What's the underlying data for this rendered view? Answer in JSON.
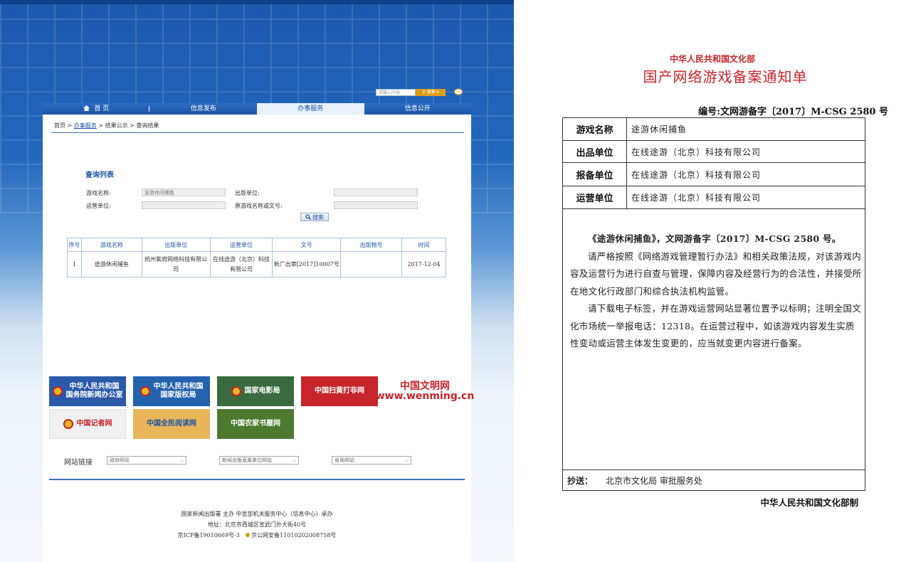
{
  "left": {
    "search": {
      "placeholder": "请输入内容",
      "button": "搜索"
    },
    "nav": {
      "items": [
        "首 页",
        "信息发布",
        "办事服务",
        "信息公开"
      ],
      "active_index": 2
    },
    "breadcrumb": {
      "home": "首页",
      "sep": " > ",
      "service": "办事服务",
      "rest": " > 结果公示 > 查询结果"
    },
    "list_title": "查询列表",
    "form": {
      "game_name_label": "游戏名称:",
      "game_name_value": "途游休闲捕鱼",
      "publisher_label": "出版单位:",
      "publisher_value": "",
      "operator_label": "运营单位:",
      "operator_value": "",
      "original_label": "原游戏名称或文号:",
      "original_value": "",
      "search_button": "搜索"
    },
    "table": {
      "headers": [
        "序号",
        "游戏名称",
        "出版单位",
        "运营单位",
        "文号",
        "出版物号",
        "时间"
      ],
      "rows": [
        [
          "1",
          "途游休闲捕鱼",
          "杭州紫府网络科技有限公司",
          "在线途游（北京）科技有限公司",
          "新广出审[2017]10007号",
          "",
          "2017-12-04"
        ]
      ]
    },
    "logos": [
      {
        "text": "中华人民共和国\n国务院新闻办公室",
        "color": "#2a5aa8"
      },
      {
        "text": "中华人民共和国\n国家版权局",
        "color": "#2462ad"
      },
      {
        "text": "国家电影局",
        "color": "#3a6b3e"
      },
      {
        "text": "中国扫黄打非网",
        "color": "#c8242b"
      },
      {
        "text": "中国文明网\nwww.wenming.cn",
        "color": "#ffffff"
      },
      {
        "text": "中国记者网",
        "color": "#f1f1f1"
      },
      {
        "text": "中国全民阅读网",
        "color": "#e8b55a"
      },
      {
        "text": "中国农家书屋网",
        "color": "#4c7a2f"
      }
    ],
    "links": {
      "label": "网站链接",
      "select1": "政府网站",
      "select2": "新闻出版直属单位网站",
      "select3": "省局网站"
    },
    "footer": {
      "line1": "国家新闻出版署 主办    中宣部机关服务中心（信息中心）承办",
      "line2": "地址：北京市西城区宣武门外大街40号",
      "line3a": "京ICP备19010669号-3",
      "line3b": "京公网安备11010202008758号"
    }
  },
  "right": {
    "subtitle": "中华人民共和国文化部",
    "title": "国产网络游戏备案通知单",
    "code": "编号:文网游备字〔2017〕M-CSG 2580 号",
    "fields": [
      {
        "key": "游戏名称",
        "value": "途游休闲捕鱼"
      },
      {
        "key": "出品单位",
        "value": "在线途游（北京）科技有限公司"
      },
      {
        "key": "报备单位",
        "value": "在线途游（北京）科技有限公司"
      },
      {
        "key": "运营单位",
        "value": "在线途游（北京）科技有限公司"
      }
    ],
    "body": {
      "p1": "《途游休闲捕鱼》，文网游备字〔2017〕M-CSG 2580 号。",
      "p2": "请严格按照《网络游戏管理暂行办法》和相关政策法规，对该游戏内容及运营行为进行自查与管理，保障内容及经营行为的合法性，并接受所在地文化行政部门和综合执法机构监管。",
      "p3": "请下载电子标签，并在游戏运营网站显著位置予以标明；注明全国文化市场统一举报电话：12318。在运营过程中，如该游戏内容发生实质性变动或运营主体发生变更的，应当就变更内容进行备案。"
    },
    "cc_label": "抄送：",
    "cc_value": "北京市文化局  审批服务处",
    "signature": "中华人民共和国文化部制"
  }
}
